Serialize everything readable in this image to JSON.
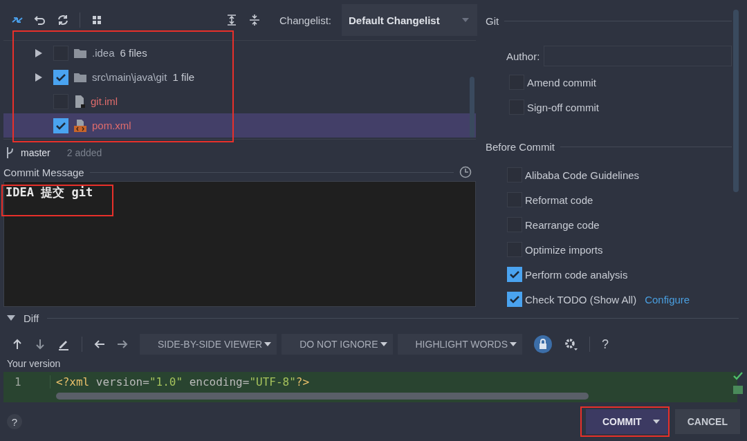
{
  "toolbar": {
    "changelist_label": "Changelist:",
    "changelist_value": "Default Changelist"
  },
  "changes": [
    {
      "kind": "folder",
      "name": ".idea",
      "count": "6 files",
      "checked": false,
      "selected": false
    },
    {
      "kind": "folder",
      "name": "src\\main\\java\\git",
      "count": "1 file",
      "checked": true,
      "selected": false
    },
    {
      "kind": "iml",
      "name": "git.iml",
      "checked": false,
      "selected": false
    },
    {
      "kind": "xml",
      "name": "pom.xml",
      "checked": true,
      "selected": true
    }
  ],
  "branch": {
    "name": "master",
    "status": "2 added"
  },
  "commit_message": {
    "label": "Commit Message",
    "value": "IDEA 提交 git"
  },
  "git": {
    "title": "Git",
    "author_label": "Author:",
    "options": [
      {
        "label": "Amend commit",
        "checked": false
      },
      {
        "label": "Sign-off commit",
        "checked": false
      }
    ]
  },
  "before_commit": {
    "title": "Before Commit",
    "options": [
      {
        "label": "Alibaba Code Guidelines",
        "checked": false
      },
      {
        "label": "Reformat code",
        "checked": false
      },
      {
        "label": "Rearrange code",
        "checked": false
      },
      {
        "label": "Optimize imports",
        "checked": false
      },
      {
        "label": "Perform code analysis",
        "checked": true
      },
      {
        "label": "Check TODO (Show All)",
        "checked": true,
        "link": "Configure"
      }
    ]
  },
  "diff": {
    "title": "Diff",
    "expanded": true,
    "viewer": "SIDE-BY-SIDE VIEWER",
    "ignore": "DO NOT IGNORE",
    "highlight": "HIGHLIGHT WORDS",
    "help": "?",
    "version_label": "Your version",
    "lines": [
      {
        "number": "1",
        "tokens": [
          {
            "kind": "tag",
            "text": "<?xml"
          },
          {
            "kind": "attr",
            "text": " version="
          },
          {
            "kind": "string",
            "text": "\"1.0\""
          },
          {
            "kind": "attr",
            "text": " encoding="
          },
          {
            "kind": "string",
            "text": "\"UTF-8\""
          },
          {
            "kind": "tag",
            "text": "?>"
          }
        ]
      }
    ]
  },
  "footer": {
    "help": "?",
    "buttons": [
      {
        "kind": "primary",
        "label": "COMMIT"
      },
      {
        "kind": "secondary",
        "label": "CANCEL"
      }
    ]
  }
}
